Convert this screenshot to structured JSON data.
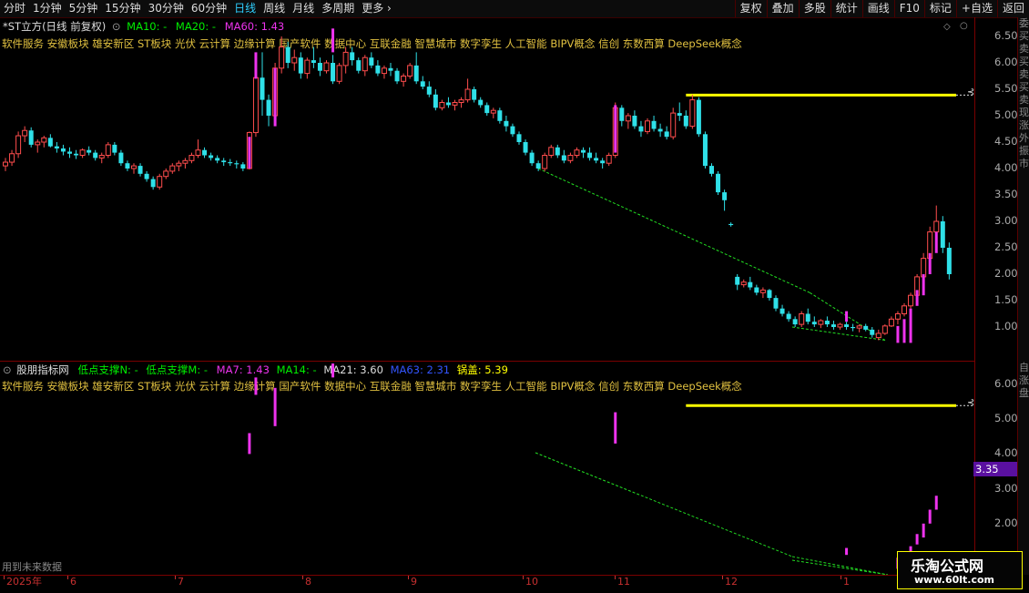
{
  "toolbar": {
    "periods": [
      "分时",
      "1分钟",
      "5分钟",
      "15分钟",
      "30分钟",
      "60分钟",
      "日线",
      "周线",
      "月线",
      "多周期",
      "更多"
    ],
    "active_period": "日线",
    "right_buttons": [
      "复权",
      "叠加",
      "多股",
      "统计",
      "画线",
      "F10",
      "标记",
      "+自选",
      "返回"
    ]
  },
  "price_panel": {
    "title": "*ST立方(日线 前复权)",
    "ma10": "MA10: -",
    "ma20": "MA20: -",
    "ma60": "MA60: 1.43",
    "concepts": "软件服务 安徽板块 雄安新区 ST板块 光伏 云计算 边缘计算 国产软件 数据中心 互联金融 智慧城市 数字孪生 人工智能 BIPV概念 信创 东数西算 DeepSeek概念",
    "y_ticks": [
      "6.50",
      "6.00",
      "5.50",
      "5.00",
      "4.50",
      "4.00",
      "3.50",
      "3.00",
      "2.50",
      "2.00",
      "1.50",
      "1.00"
    ],
    "side_chars": [
      "委",
      "买",
      "卖",
      "买",
      "卖",
      "买",
      "卖",
      "现",
      "涨",
      "外",
      "振",
      "市"
    ]
  },
  "indicator_panel": {
    "name": "股朋指标网",
    "n_label": "低点支撑N: -",
    "m_label": "低点支撑M: -",
    "ma7": "MA7: 1.43",
    "ma14": "MA14: -",
    "ma21": "MA21: 3.60",
    "ma63": "MA63: 2.31",
    "lid": "锅盖: 5.39",
    "concepts": "软件服务 安徽板块 雄安新区 ST板块 光伏 云计算 边缘计算 国产软件 数据中心 互联金融 智慧城市 数字孪生 人工智能 BIPV概念 信创 东数西算 DeepSeek概念",
    "y_ticks": [
      "6.00",
      "5.00",
      "4.00",
      "3.00",
      "2.00"
    ],
    "current_price": "3.35",
    "footnote": "用到未来数据",
    "side_chars": [
      "自",
      "涨",
      "盘"
    ]
  },
  "date_axis": [
    "2025年",
    "6",
    "7",
    "8",
    "9",
    "10",
    "11",
    "12",
    "1"
  ],
  "watermark": {
    "title": "乐淘公式网",
    "url": "www.60lt.com"
  },
  "colors": {
    "up": "#ff4d4d",
    "down": "#2fe0e8",
    "ma10": "#00ee00",
    "ma60": "#ee33ee",
    "lid_line": "#ffff00",
    "support": "#22dd22",
    "concept": "#e0c040",
    "grid": "#7a0000"
  },
  "chart_data": {
    "type": "candlestick",
    "y_axis_range": [
      0.7,
      6.7
    ],
    "lid_level": 5.39,
    "ohlc": [
      [
        4.05,
        4.2,
        3.95,
        4.12
      ],
      [
        4.12,
        4.35,
        4.05,
        4.28
      ],
      [
        4.28,
        4.7,
        4.2,
        4.62
      ],
      [
        4.62,
        4.8,
        4.5,
        4.72
      ],
      [
        4.72,
        4.78,
        4.4,
        4.45
      ],
      [
        4.45,
        4.55,
        4.3,
        4.5
      ],
      [
        4.5,
        4.62,
        4.4,
        4.58
      ],
      [
        4.58,
        4.65,
        4.4,
        4.42
      ],
      [
        4.42,
        4.5,
        4.3,
        4.38
      ],
      [
        4.38,
        4.45,
        4.25,
        4.32
      ],
      [
        4.32,
        4.4,
        4.2,
        4.28
      ],
      [
        4.28,
        4.35,
        4.18,
        4.25
      ],
      [
        4.25,
        4.38,
        4.2,
        4.35
      ],
      [
        4.35,
        4.42,
        4.25,
        4.3
      ],
      [
        4.3,
        4.35,
        4.15,
        4.2
      ],
      [
        4.2,
        4.3,
        4.1,
        4.25
      ],
      [
        4.25,
        4.5,
        4.2,
        4.45
      ],
      [
        4.45,
        4.5,
        4.25,
        4.3
      ],
      [
        4.3,
        4.35,
        4.05,
        4.1
      ],
      [
        4.1,
        4.15,
        3.95,
        4.0
      ],
      [
        4.0,
        4.1,
        3.9,
        4.05
      ],
      [
        4.05,
        4.1,
        3.85,
        3.9
      ],
      [
        3.9,
        3.95,
        3.75,
        3.8
      ],
      [
        3.8,
        3.85,
        3.6,
        3.65
      ],
      [
        3.65,
        3.9,
        3.6,
        3.85
      ],
      [
        3.85,
        4.0,
        3.8,
        3.95
      ],
      [
        3.95,
        4.1,
        3.9,
        4.05
      ],
      [
        4.05,
        4.15,
        3.95,
        4.1
      ],
      [
        4.1,
        4.2,
        4.0,
        4.15
      ],
      [
        4.15,
        4.3,
        4.1,
        4.25
      ],
      [
        4.25,
        4.55,
        4.2,
        4.35
      ],
      [
        4.35,
        4.4,
        4.2,
        4.25
      ],
      [
        4.25,
        4.3,
        4.15,
        4.2
      ],
      [
        4.2,
        4.25,
        4.1,
        4.15
      ],
      [
        4.15,
        4.2,
        4.05,
        4.12
      ],
      [
        4.12,
        4.18,
        4.05,
        4.1
      ],
      [
        4.1,
        4.15,
        4.0,
        4.08
      ],
      [
        4.08,
        4.12,
        3.95,
        4.0
      ],
      [
        4.0,
        4.7,
        3.98,
        4.68
      ],
      [
        4.68,
        5.8,
        4.6,
        5.72
      ],
      [
        5.72,
        6.2,
        5.0,
        5.3
      ],
      [
        5.3,
        5.4,
        4.8,
        5.0
      ],
      [
        5.0,
        6.0,
        4.9,
        5.9
      ],
      [
        5.9,
        6.5,
        5.8,
        6.3
      ],
      [
        6.3,
        6.4,
        5.9,
        6.0
      ],
      [
        6.0,
        6.25,
        5.85,
        6.1
      ],
      [
        6.1,
        6.2,
        5.7,
        5.8
      ],
      [
        5.8,
        6.1,
        5.7,
        6.05
      ],
      [
        6.05,
        6.3,
        5.9,
        6.0
      ],
      [
        6.0,
        6.1,
        5.75,
        5.85
      ],
      [
        5.85,
        6.05,
        5.8,
        6.0
      ],
      [
        6.0,
        6.15,
        5.6,
        5.65
      ],
      [
        5.65,
        6.0,
        5.6,
        5.95
      ],
      [
        5.95,
        6.3,
        5.8,
        6.2
      ],
      [
        6.2,
        6.3,
        5.95,
        6.05
      ],
      [
        6.05,
        6.1,
        5.8,
        5.85
      ],
      [
        5.85,
        6.15,
        5.75,
        6.1
      ],
      [
        6.1,
        6.2,
        5.9,
        5.95
      ],
      [
        5.95,
        6.05,
        5.75,
        5.8
      ],
      [
        5.8,
        5.95,
        5.7,
        5.9
      ],
      [
        5.9,
        6.0,
        5.75,
        5.85
      ],
      [
        5.85,
        5.9,
        5.6,
        5.65
      ],
      [
        5.65,
        5.8,
        5.55,
        5.75
      ],
      [
        5.75,
        6.0,
        5.7,
        5.95
      ],
      [
        5.95,
        6.2,
        5.6,
        5.65
      ],
      [
        5.65,
        5.75,
        5.5,
        5.55
      ],
      [
        5.55,
        5.65,
        5.35,
        5.4
      ],
      [
        5.4,
        5.5,
        5.1,
        5.15
      ],
      [
        5.15,
        5.3,
        5.1,
        5.25
      ],
      [
        5.25,
        5.35,
        5.15,
        5.2
      ],
      [
        5.2,
        5.3,
        5.1,
        5.25
      ],
      [
        5.25,
        5.35,
        5.15,
        5.3
      ],
      [
        5.3,
        5.7,
        5.25,
        5.5
      ],
      [
        5.5,
        5.55,
        5.25,
        5.3
      ],
      [
        5.3,
        5.35,
        5.15,
        5.2
      ],
      [
        5.2,
        5.25,
        5.0,
        5.05
      ],
      [
        5.05,
        5.15,
        4.95,
        5.1
      ],
      [
        5.1,
        5.15,
        4.85,
        4.9
      ],
      [
        4.9,
        5.0,
        4.7,
        4.8
      ],
      [
        4.8,
        4.85,
        4.6,
        4.65
      ],
      [
        4.65,
        4.7,
        4.45,
        4.5
      ],
      [
        4.5,
        4.55,
        4.25,
        4.3
      ],
      [
        4.3,
        4.35,
        4.05,
        4.1
      ],
      [
        4.1,
        4.15,
        3.95,
        4.0
      ],
      [
        4.0,
        4.3,
        3.95,
        4.25
      ],
      [
        4.25,
        4.45,
        4.2,
        4.4
      ],
      [
        4.4,
        4.45,
        4.2,
        4.25
      ],
      [
        4.25,
        4.35,
        4.1,
        4.15
      ],
      [
        4.15,
        4.3,
        4.1,
        4.25
      ],
      [
        4.25,
        4.4,
        4.2,
        4.35
      ],
      [
        4.35,
        4.4,
        4.2,
        4.3
      ],
      [
        4.3,
        4.4,
        4.15,
        4.2
      ],
      [
        4.2,
        4.3,
        4.1,
        4.15
      ],
      [
        4.15,
        4.2,
        4.0,
        4.1
      ],
      [
        4.1,
        4.3,
        4.05,
        4.25
      ],
      [
        4.25,
        5.25,
        4.2,
        5.15
      ],
      [
        5.15,
        5.2,
        4.8,
        4.9
      ],
      [
        4.9,
        5.05,
        4.75,
        5.0
      ],
      [
        5.0,
        5.1,
        4.75,
        4.8
      ],
      [
        4.8,
        4.9,
        4.6,
        4.7
      ],
      [
        4.7,
        4.95,
        4.65,
        4.9
      ],
      [
        4.9,
        5.0,
        4.7,
        4.75
      ],
      [
        4.75,
        4.85,
        4.6,
        4.7
      ],
      [
        4.7,
        4.8,
        4.55,
        4.6
      ],
      [
        4.6,
        5.15,
        4.55,
        5.05
      ],
      [
        5.05,
        5.25,
        4.9,
        5.0
      ],
      [
        5.0,
        5.1,
        4.75,
        4.8
      ],
      [
        4.8,
        5.4,
        4.75,
        5.3
      ],
      [
        5.3,
        5.35,
        4.6,
        4.65
      ],
      [
        4.65,
        4.7,
        4.0,
        4.05
      ],
      [
        4.05,
        4.1,
        3.85,
        3.9
      ],
      [
        3.9,
        3.95,
        3.5,
        3.55
      ],
      [
        3.55,
        3.6,
        3.2,
        3.4
      ],
      [
        2.95,
        2.98,
        2.9,
        2.93
      ],
      [
        1.95,
        2.0,
        1.7,
        1.8
      ],
      [
        1.8,
        1.9,
        1.75,
        1.85
      ],
      [
        1.85,
        1.95,
        1.7,
        1.75
      ],
      [
        1.75,
        1.8,
        1.6,
        1.65
      ],
      [
        1.65,
        1.75,
        1.55,
        1.7
      ],
      [
        1.7,
        1.72,
        1.5,
        1.55
      ],
      [
        1.55,
        1.6,
        1.3,
        1.35
      ],
      [
        1.35,
        1.42,
        1.2,
        1.25
      ],
      [
        1.25,
        1.3,
        1.1,
        1.15
      ],
      [
        1.15,
        1.2,
        1.0,
        1.05
      ],
      [
        1.05,
        1.3,
        1.0,
        1.25
      ],
      [
        1.25,
        1.35,
        1.05,
        1.1
      ],
      [
        1.1,
        1.2,
        1.0,
        1.05
      ],
      [
        1.05,
        1.15,
        0.98,
        1.12
      ],
      [
        1.12,
        1.2,
        1.0,
        1.05
      ],
      [
        1.05,
        1.12,
        0.95,
        1.0
      ],
      [
        1.0,
        1.08,
        0.95,
        1.05
      ],
      [
        1.05,
        1.1,
        0.95,
        1.0
      ],
      [
        1.0,
        1.06,
        0.92,
        0.98
      ],
      [
        0.98,
        1.05,
        0.9,
        1.02
      ],
      [
        1.02,
        1.06,
        0.92,
        0.95
      ],
      [
        0.95,
        1.0,
        0.8,
        0.85
      ],
      [
        0.8,
        0.95,
        0.75,
        0.88
      ],
      [
        0.88,
        1.05,
        0.85,
        1.02
      ],
      [
        1.02,
        1.2,
        1.0,
        1.15
      ],
      [
        1.15,
        1.3,
        1.05,
        1.25
      ],
      [
        1.25,
        1.45,
        1.2,
        1.4
      ],
      [
        1.4,
        1.65,
        1.35,
        1.6
      ],
      [
        1.6,
        2.0,
        1.55,
        1.95
      ],
      [
        1.95,
        2.4,
        1.9,
        2.3
      ],
      [
        2.3,
        2.9,
        2.25,
        2.8
      ],
      [
        2.8,
        3.3,
        2.7,
        3.0
      ],
      [
        3.0,
        3.1,
        2.4,
        2.5
      ],
      [
        2.5,
        2.6,
        1.9,
        2.0
      ]
    ],
    "volume_spikes": [
      {
        "day": 38,
        "low": 4.0,
        "high": 4.6
      },
      {
        "day": 39,
        "low": 5.7,
        "high": 6.2
      },
      {
        "day": 42,
        "low": 4.8,
        "high": 5.9
      },
      {
        "day": 51,
        "low": 6.2,
        "high": 6.65
      },
      {
        "day": 95,
        "low": 4.3,
        "high": 5.2
      },
      {
        "day": 131,
        "low": 1.1,
        "high": 1.3
      },
      {
        "day": 139,
        "low": 0.7,
        "high": 1.02
      },
      {
        "day": 140,
        "low": 0.7,
        "high": 1.15
      },
      {
        "day": 141,
        "low": 0.7,
        "high": 1.35
      },
      {
        "day": 142,
        "low": 1.4,
        "high": 1.7
      },
      {
        "day": 143,
        "low": 1.6,
        "high": 2.0
      },
      {
        "day": 144,
        "low": 2.0,
        "high": 2.4
      },
      {
        "day": 145,
        "low": 2.4,
        "high": 2.8
      }
    ]
  }
}
